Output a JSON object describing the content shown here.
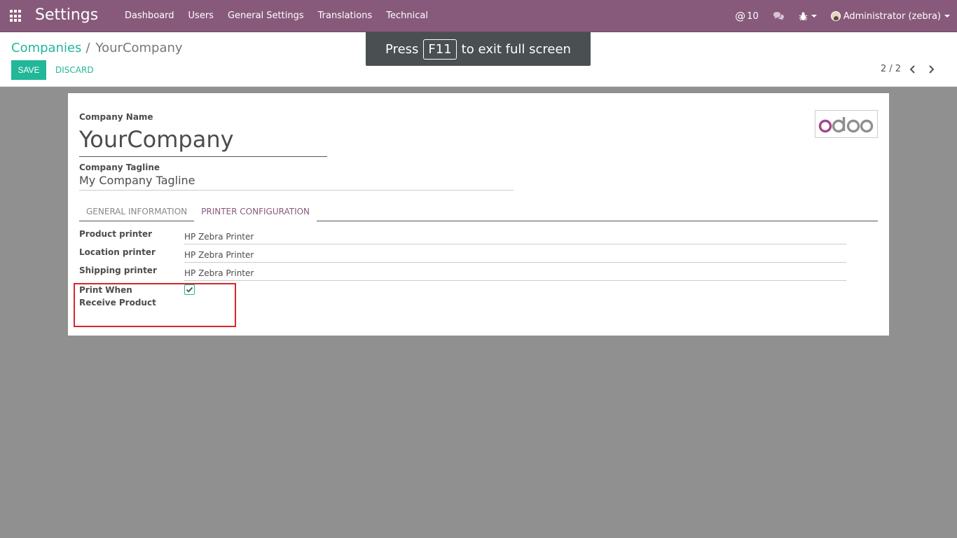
{
  "navbar": {
    "app_title": "Settings",
    "menu": [
      "Dashboard",
      "Users",
      "General Settings",
      "Translations",
      "Technical"
    ],
    "messages_count": "10",
    "user": "Administrator (zebra)"
  },
  "control_panel": {
    "breadcrumb_parent": "Companies",
    "breadcrumb_sep": "/",
    "breadcrumb_current": "YourCompany",
    "save_label": "SAVE",
    "discard_label": "DISCARD",
    "pager": "2 / 2"
  },
  "toast": {
    "press": "Press",
    "key": "F11",
    "rest": "to exit full screen"
  },
  "form": {
    "company_name_label": "Company Name",
    "company_name": "YourCompany",
    "tagline_label": "Company Tagline",
    "tagline": "My Company Tagline",
    "logo_text": "odoo",
    "tabs": [
      "GENERAL INFORMATION",
      "PRINTER CONFIGURATION"
    ],
    "fields": [
      {
        "label": "Product printer",
        "value": "HP Zebra Printer"
      },
      {
        "label": "Location printer",
        "value": "HP Zebra Printer"
      },
      {
        "label": "Shipping printer",
        "value": "HP Zebra Printer"
      }
    ],
    "print_receive_label": "Print When Receive Product",
    "print_receive_checked": true
  },
  "colors": {
    "brand": "#875a7b",
    "accent": "#21b799",
    "highlight": "#d9262b"
  }
}
